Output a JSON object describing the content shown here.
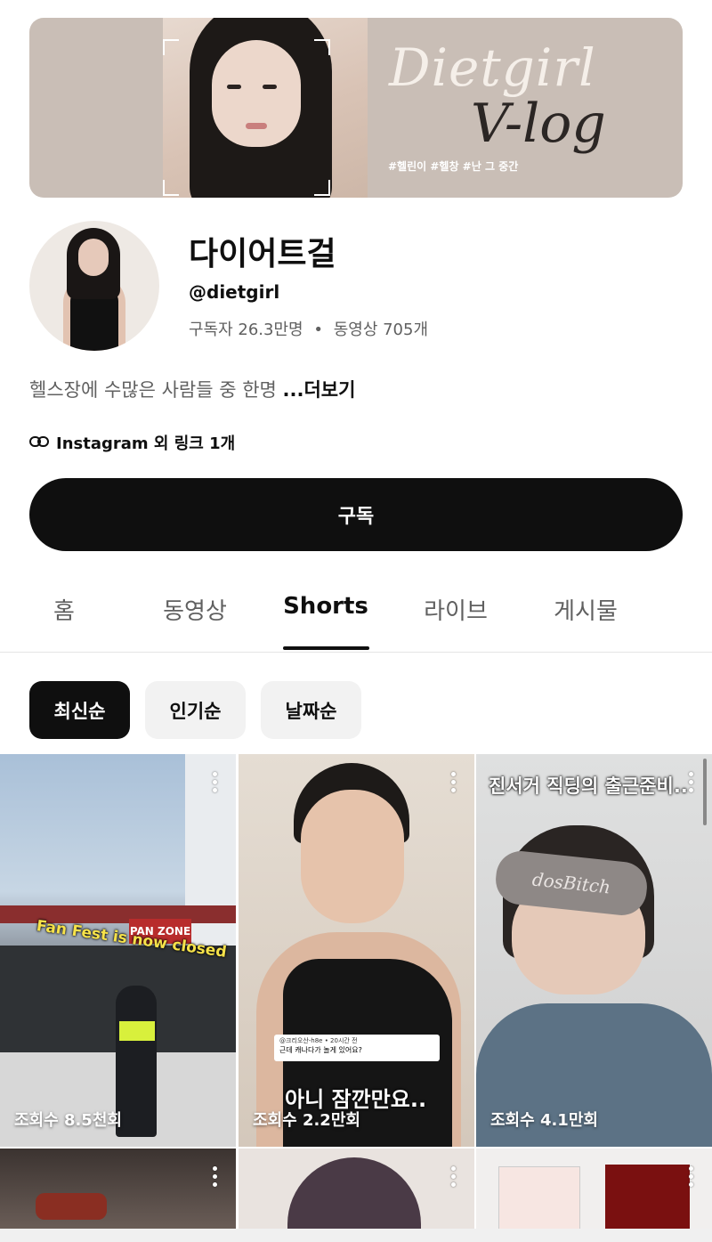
{
  "banner": {
    "title_line1": "Dietgirl",
    "title_line2": "V-log",
    "hashtags": "#헬린이 #헬창 #난 그 중간"
  },
  "channel": {
    "name": "다이어트걸",
    "handle": "@dietgirl",
    "subscribers": "구독자 26.3만명",
    "separator": "•",
    "videos": "동영상 705개",
    "description": "헬스장에 수많은 사람들 중 한명 ",
    "more": "...더보기",
    "links": "Instagram 외 링크 1개",
    "subscribe_label": "구독"
  },
  "tabs": [
    {
      "label": "홈"
    },
    {
      "label": "동영상"
    },
    {
      "label": "Shorts"
    },
    {
      "label": "라이브"
    },
    {
      "label": "게시물"
    }
  ],
  "filters": [
    {
      "label": "최신순"
    },
    {
      "label": "인기순"
    },
    {
      "label": "날짜순"
    }
  ],
  "shorts": [
    {
      "views": "조회수 8.5천회",
      "overlay": "Fan Fest is now closed",
      "sign": "PAN ZONE"
    },
    {
      "views": "조회수 2.2만회",
      "overlay": "아니 잠깐만요..",
      "comment_user": "@크리오산-h8e • 20시간 전",
      "comment_text": "근데 캐나다가 놀게 있어요?"
    },
    {
      "views": "조회수 4.1만회",
      "overlay": "진서거 직딩의 출근준비..",
      "mask_text": "dosBitch"
    }
  ],
  "colors": {
    "accent": "#0f0f0f",
    "chip_bg": "#f2f2f2",
    "banner_bg": "#c9beb6"
  },
  "icons": [
    "link-icon",
    "more-vert-icon"
  ]
}
